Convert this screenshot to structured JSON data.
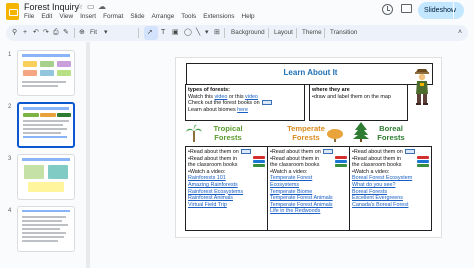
{
  "app": {
    "title": "Forest Inquiry",
    "menu": [
      "File",
      "Edit",
      "View",
      "Insert",
      "Format",
      "Slide",
      "Arrange",
      "Tools",
      "Extensions",
      "Help"
    ],
    "slideshow_label": "Slideshow"
  },
  "toolbar": {
    "zoom": "Fit",
    "background_label": "Background",
    "layout_label": "Layout",
    "theme_label": "Theme",
    "transition_label": "Transition"
  },
  "filmstrip": {
    "slide_numbers": [
      "1",
      "2",
      "3",
      "4"
    ],
    "selected": "2"
  },
  "slide": {
    "title": "Learn About It",
    "intro": {
      "heading": "types of forests:",
      "line1_pre": "Watch this ",
      "line1_link1": "video",
      "line1_mid": " or this ",
      "line1_link2": "video",
      "line2": "Check out the forest books on",
      "line3_pre": "Learn about biomes ",
      "line3_link": "here"
    },
    "where": {
      "heading": "where they are",
      "text": "•draw and label them on the map"
    },
    "biomes": {
      "tropical": "Tropical Forests",
      "temperate": "Temperate Forests",
      "boreal": "Boreal Forests"
    },
    "columns": [
      {
        "read1": "•Read about them on",
        "read2": "•Read about them in the classroom books",
        "watch": "•Watch a video:",
        "links": [
          "Rainforests 101",
          "Amazing Rainforests",
          "Rainforest Ecosystems",
          "Rainforest Animals",
          "Virtual Field Trip"
        ]
      },
      {
        "read1": "•Read about them on",
        "read2": "•Read about them in the classroom books",
        "watch": "•Watch a video:",
        "links": [
          "Temperate Forest",
          "Ecosystems",
          "Temperate Biome",
          "Temperate Forest Animals",
          "Temperate Forest Animals",
          "Life in the Redwoods"
        ]
      },
      {
        "read1": "•Read about them on",
        "read2": "•Read about them in the classroom books",
        "watch": "•Watch a video:",
        "links": [
          "Boreal Forest Ecosystem",
          "What do you see?",
          "Boreal Forests",
          "Excellent Evergreens",
          "Canada's Boreal Forest"
        ]
      }
    ]
  }
}
